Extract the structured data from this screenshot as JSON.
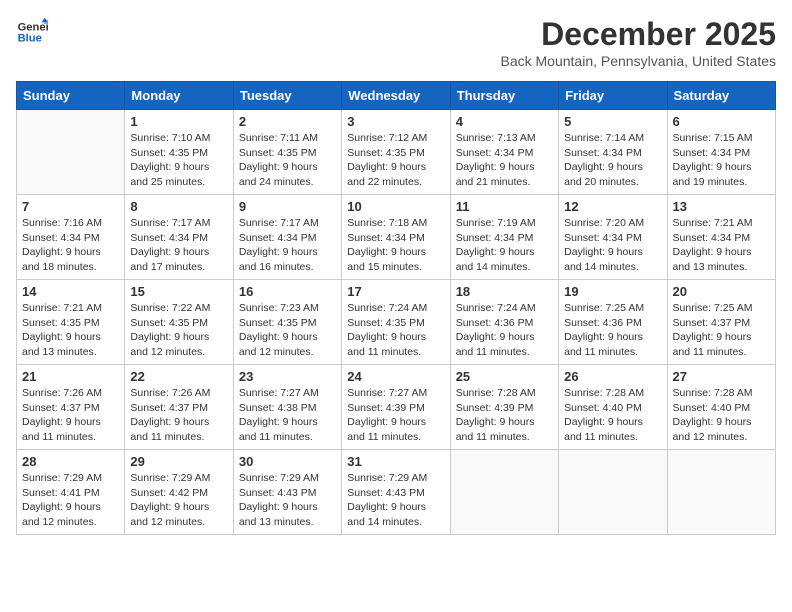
{
  "header": {
    "logo_line1": "General",
    "logo_line2": "Blue",
    "month": "December 2025",
    "location": "Back Mountain, Pennsylvania, United States"
  },
  "weekdays": [
    "Sunday",
    "Monday",
    "Tuesday",
    "Wednesday",
    "Thursday",
    "Friday",
    "Saturday"
  ],
  "weeks": [
    [
      {
        "day": "",
        "info": ""
      },
      {
        "day": "1",
        "info": "Sunrise: 7:10 AM\nSunset: 4:35 PM\nDaylight: 9 hours\nand 25 minutes."
      },
      {
        "day": "2",
        "info": "Sunrise: 7:11 AM\nSunset: 4:35 PM\nDaylight: 9 hours\nand 24 minutes."
      },
      {
        "day": "3",
        "info": "Sunrise: 7:12 AM\nSunset: 4:35 PM\nDaylight: 9 hours\nand 22 minutes."
      },
      {
        "day": "4",
        "info": "Sunrise: 7:13 AM\nSunset: 4:34 PM\nDaylight: 9 hours\nand 21 minutes."
      },
      {
        "day": "5",
        "info": "Sunrise: 7:14 AM\nSunset: 4:34 PM\nDaylight: 9 hours\nand 20 minutes."
      },
      {
        "day": "6",
        "info": "Sunrise: 7:15 AM\nSunset: 4:34 PM\nDaylight: 9 hours\nand 19 minutes."
      }
    ],
    [
      {
        "day": "7",
        "info": "Sunrise: 7:16 AM\nSunset: 4:34 PM\nDaylight: 9 hours\nand 18 minutes."
      },
      {
        "day": "8",
        "info": "Sunrise: 7:17 AM\nSunset: 4:34 PM\nDaylight: 9 hours\nand 17 minutes."
      },
      {
        "day": "9",
        "info": "Sunrise: 7:17 AM\nSunset: 4:34 PM\nDaylight: 9 hours\nand 16 minutes."
      },
      {
        "day": "10",
        "info": "Sunrise: 7:18 AM\nSunset: 4:34 PM\nDaylight: 9 hours\nand 15 minutes."
      },
      {
        "day": "11",
        "info": "Sunrise: 7:19 AM\nSunset: 4:34 PM\nDaylight: 9 hours\nand 14 minutes."
      },
      {
        "day": "12",
        "info": "Sunrise: 7:20 AM\nSunset: 4:34 PM\nDaylight: 9 hours\nand 14 minutes."
      },
      {
        "day": "13",
        "info": "Sunrise: 7:21 AM\nSunset: 4:34 PM\nDaylight: 9 hours\nand 13 minutes."
      }
    ],
    [
      {
        "day": "14",
        "info": "Sunrise: 7:21 AM\nSunset: 4:35 PM\nDaylight: 9 hours\nand 13 minutes."
      },
      {
        "day": "15",
        "info": "Sunrise: 7:22 AM\nSunset: 4:35 PM\nDaylight: 9 hours\nand 12 minutes."
      },
      {
        "day": "16",
        "info": "Sunrise: 7:23 AM\nSunset: 4:35 PM\nDaylight: 9 hours\nand 12 minutes."
      },
      {
        "day": "17",
        "info": "Sunrise: 7:24 AM\nSunset: 4:35 PM\nDaylight: 9 hours\nand 11 minutes."
      },
      {
        "day": "18",
        "info": "Sunrise: 7:24 AM\nSunset: 4:36 PM\nDaylight: 9 hours\nand 11 minutes."
      },
      {
        "day": "19",
        "info": "Sunrise: 7:25 AM\nSunset: 4:36 PM\nDaylight: 9 hours\nand 11 minutes."
      },
      {
        "day": "20",
        "info": "Sunrise: 7:25 AM\nSunset: 4:37 PM\nDaylight: 9 hours\nand 11 minutes."
      }
    ],
    [
      {
        "day": "21",
        "info": "Sunrise: 7:26 AM\nSunset: 4:37 PM\nDaylight: 9 hours\nand 11 minutes."
      },
      {
        "day": "22",
        "info": "Sunrise: 7:26 AM\nSunset: 4:37 PM\nDaylight: 9 hours\nand 11 minutes."
      },
      {
        "day": "23",
        "info": "Sunrise: 7:27 AM\nSunset: 4:38 PM\nDaylight: 9 hours\nand 11 minutes."
      },
      {
        "day": "24",
        "info": "Sunrise: 7:27 AM\nSunset: 4:39 PM\nDaylight: 9 hours\nand 11 minutes."
      },
      {
        "day": "25",
        "info": "Sunrise: 7:28 AM\nSunset: 4:39 PM\nDaylight: 9 hours\nand 11 minutes."
      },
      {
        "day": "26",
        "info": "Sunrise: 7:28 AM\nSunset: 4:40 PM\nDaylight: 9 hours\nand 11 minutes."
      },
      {
        "day": "27",
        "info": "Sunrise: 7:28 AM\nSunset: 4:40 PM\nDaylight: 9 hours\nand 12 minutes."
      }
    ],
    [
      {
        "day": "28",
        "info": "Sunrise: 7:29 AM\nSunset: 4:41 PM\nDaylight: 9 hours\nand 12 minutes."
      },
      {
        "day": "29",
        "info": "Sunrise: 7:29 AM\nSunset: 4:42 PM\nDaylight: 9 hours\nand 12 minutes."
      },
      {
        "day": "30",
        "info": "Sunrise: 7:29 AM\nSunset: 4:43 PM\nDaylight: 9 hours\nand 13 minutes."
      },
      {
        "day": "31",
        "info": "Sunrise: 7:29 AM\nSunset: 4:43 PM\nDaylight: 9 hours\nand 14 minutes."
      },
      {
        "day": "",
        "info": ""
      },
      {
        "day": "",
        "info": ""
      },
      {
        "day": "",
        "info": ""
      }
    ]
  ]
}
